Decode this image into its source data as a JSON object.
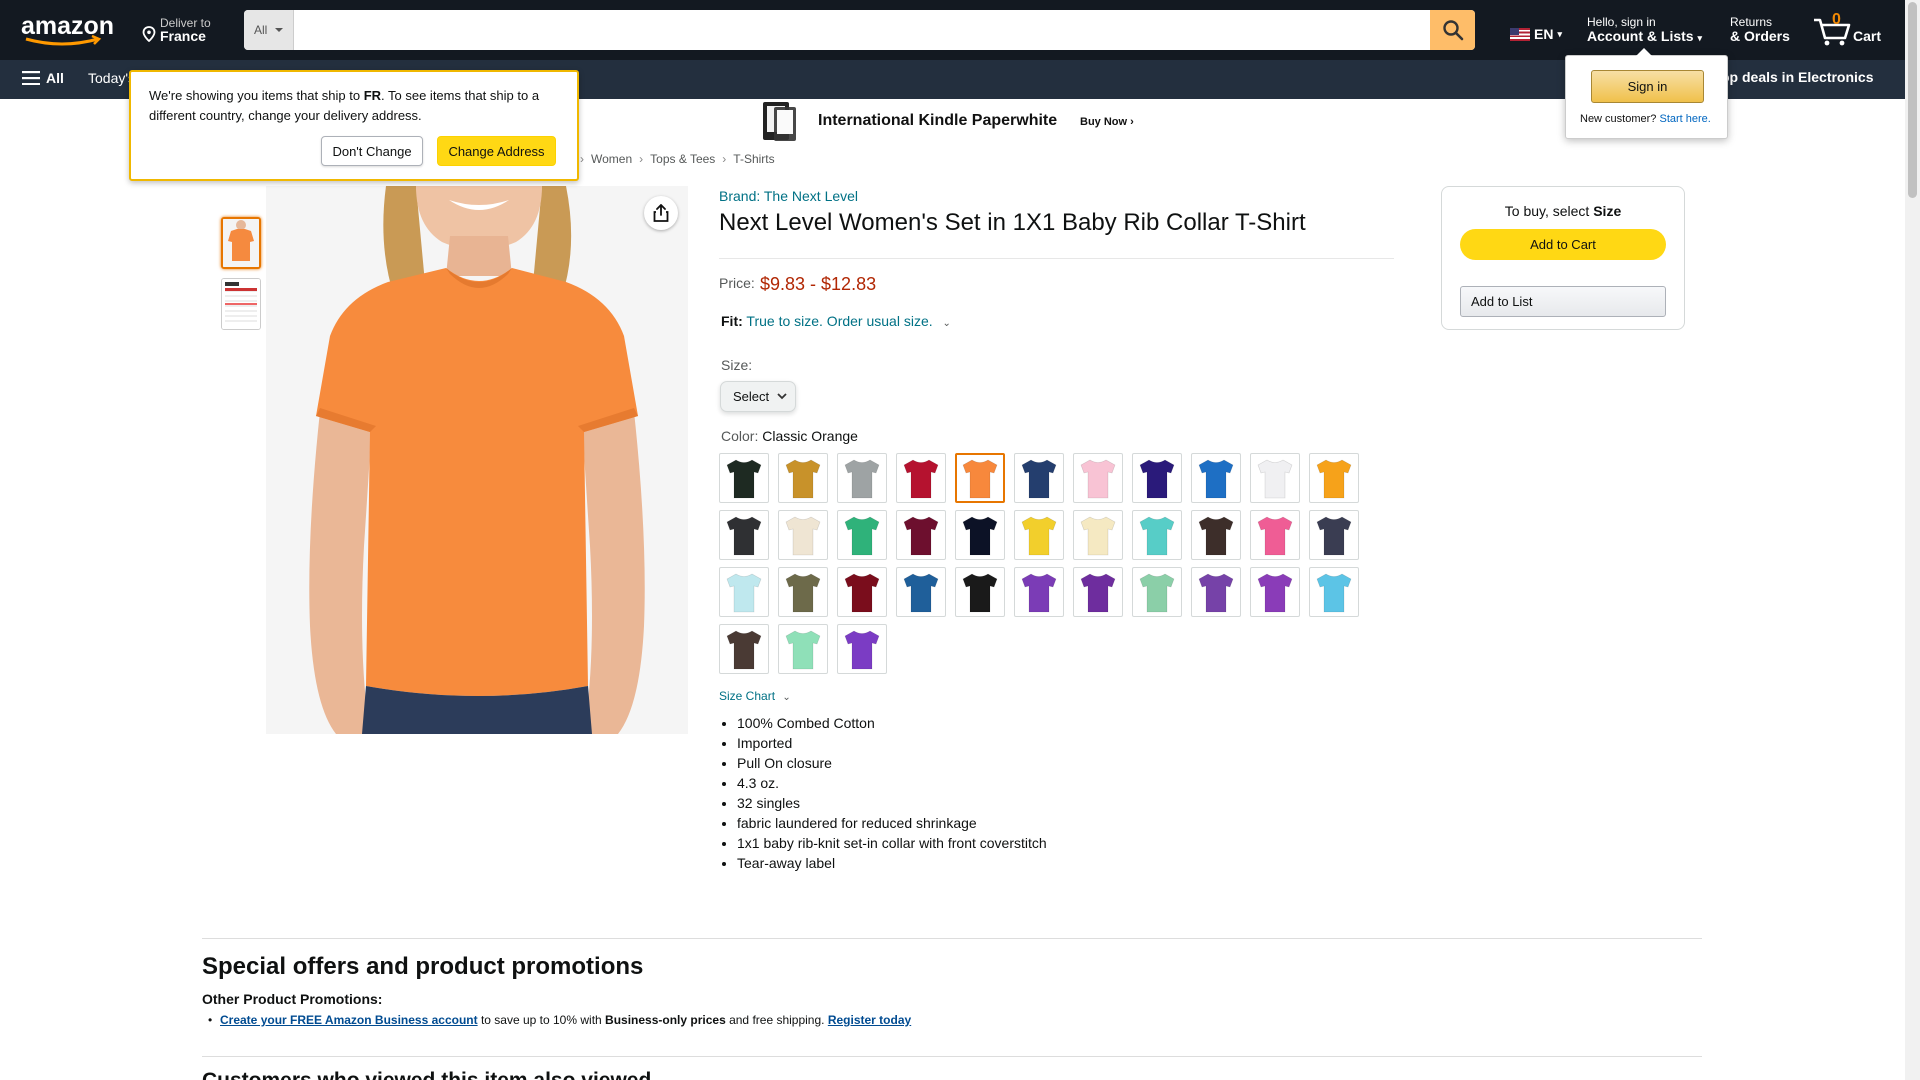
{
  "header": {
    "deliver_line1": "Deliver to",
    "deliver_line2": "France",
    "search_category": "All",
    "search_placeholder": "",
    "lang": "EN",
    "account_line1": "Hello, sign in",
    "account_line2": "Account & Lists",
    "returns_line1": "Returns",
    "returns_line2": "& Orders",
    "cart_count": "0",
    "cart_label": "Cart"
  },
  "nav": {
    "all_label": "All",
    "today_label": "Today's",
    "deals_label": "op deals in Electronics"
  },
  "ship_popover": {
    "text_before": "We're showing you items that ship to ",
    "country": "FR",
    "text_after": ". To see items that ship to a different country, change your delivery address.",
    "dont_change": "Don't Change",
    "change_address": "Change Address"
  },
  "signin_popover": {
    "button": "Sign in",
    "new_customer": "New customer?",
    "start_here": "Start here."
  },
  "banner": {
    "title": "International Kindle Paperwhite",
    "cta": "Buy Now ›"
  },
  "breadcrumb": [
    "Women",
    "Tops & Tees",
    "T-Shirts"
  ],
  "product": {
    "brand": "Brand: The Next Level",
    "title": "Next Level Women's Set in 1X1 Baby Rib Collar T-Shirt",
    "price_label": "Price:",
    "price": "$9.83 - $12.83",
    "fit_label": "Fit:",
    "fit_value": "True to size. Order usual size.",
    "size_label": "Size:",
    "size_select": "Select",
    "color_label": "Color:",
    "color_value": "Classic Orange",
    "size_chart": "Size Chart",
    "bullets": [
      "100% Combed Cotton",
      "Imported",
      "Pull On closure",
      "4.3 oz.",
      "32 singles",
      "fabric laundered for reduced shrinkage",
      "1x1 baby rib-knit set-in collar with front coverstitch",
      "Tear-away label"
    ],
    "swatch_colors": [
      "#1e2a22",
      "#c8922a",
      "#9ea3a4",
      "#b5122f",
      "#f7883c",
      "#243e6e",
      "#f8c3d4",
      "#2a1a7a",
      "#1e6fc4",
      "#f0f0f2",
      "#f6a21a",
      "#2f3033",
      "#efe5d3",
      "#2fb27a",
      "#6d0f2e",
      "#0c1226",
      "#f2cf2c",
      "#f5e9c2",
      "#57cdc7",
      "#3d2e2a",
      "#ef5d95",
      "#3a3d52",
      "#bfe8ee",
      "#6d6a4a",
      "#7a0d1c",
      "#1f5f9a",
      "#1a1a1a",
      "#7b3cb6",
      "#6e2d9e",
      "#8bcfa8",
      "#7642a8",
      "#8a3cb8",
      "#5cc4e6",
      "#4a3a34",
      "#8fe0b8",
      "#7b3cc4"
    ],
    "selected_swatch": 4
  },
  "buybox": {
    "title_prefix": "To buy, select ",
    "title_bold": "Size",
    "add_to_cart": "Add to Cart",
    "add_to_list": "Add to List"
  },
  "promotions": {
    "heading": "Special offers and product promotions",
    "subheading": "Other Product Promotions:",
    "link1": "Create your FREE Amazon Business account",
    "mid_text": " to save up to 10% with ",
    "bold_text": "Business-only prices",
    "after_text": " and free shipping. ",
    "link2": "Register today"
  },
  "customers_heading": "Customers who viewed this item also viewed",
  "colors": {
    "header_bg": "#131921",
    "nav_bg": "#232f3e",
    "accent_yellow": "#ffd814",
    "search_btn": "#febd69",
    "price_red": "#b12704",
    "link_teal": "#007185"
  }
}
